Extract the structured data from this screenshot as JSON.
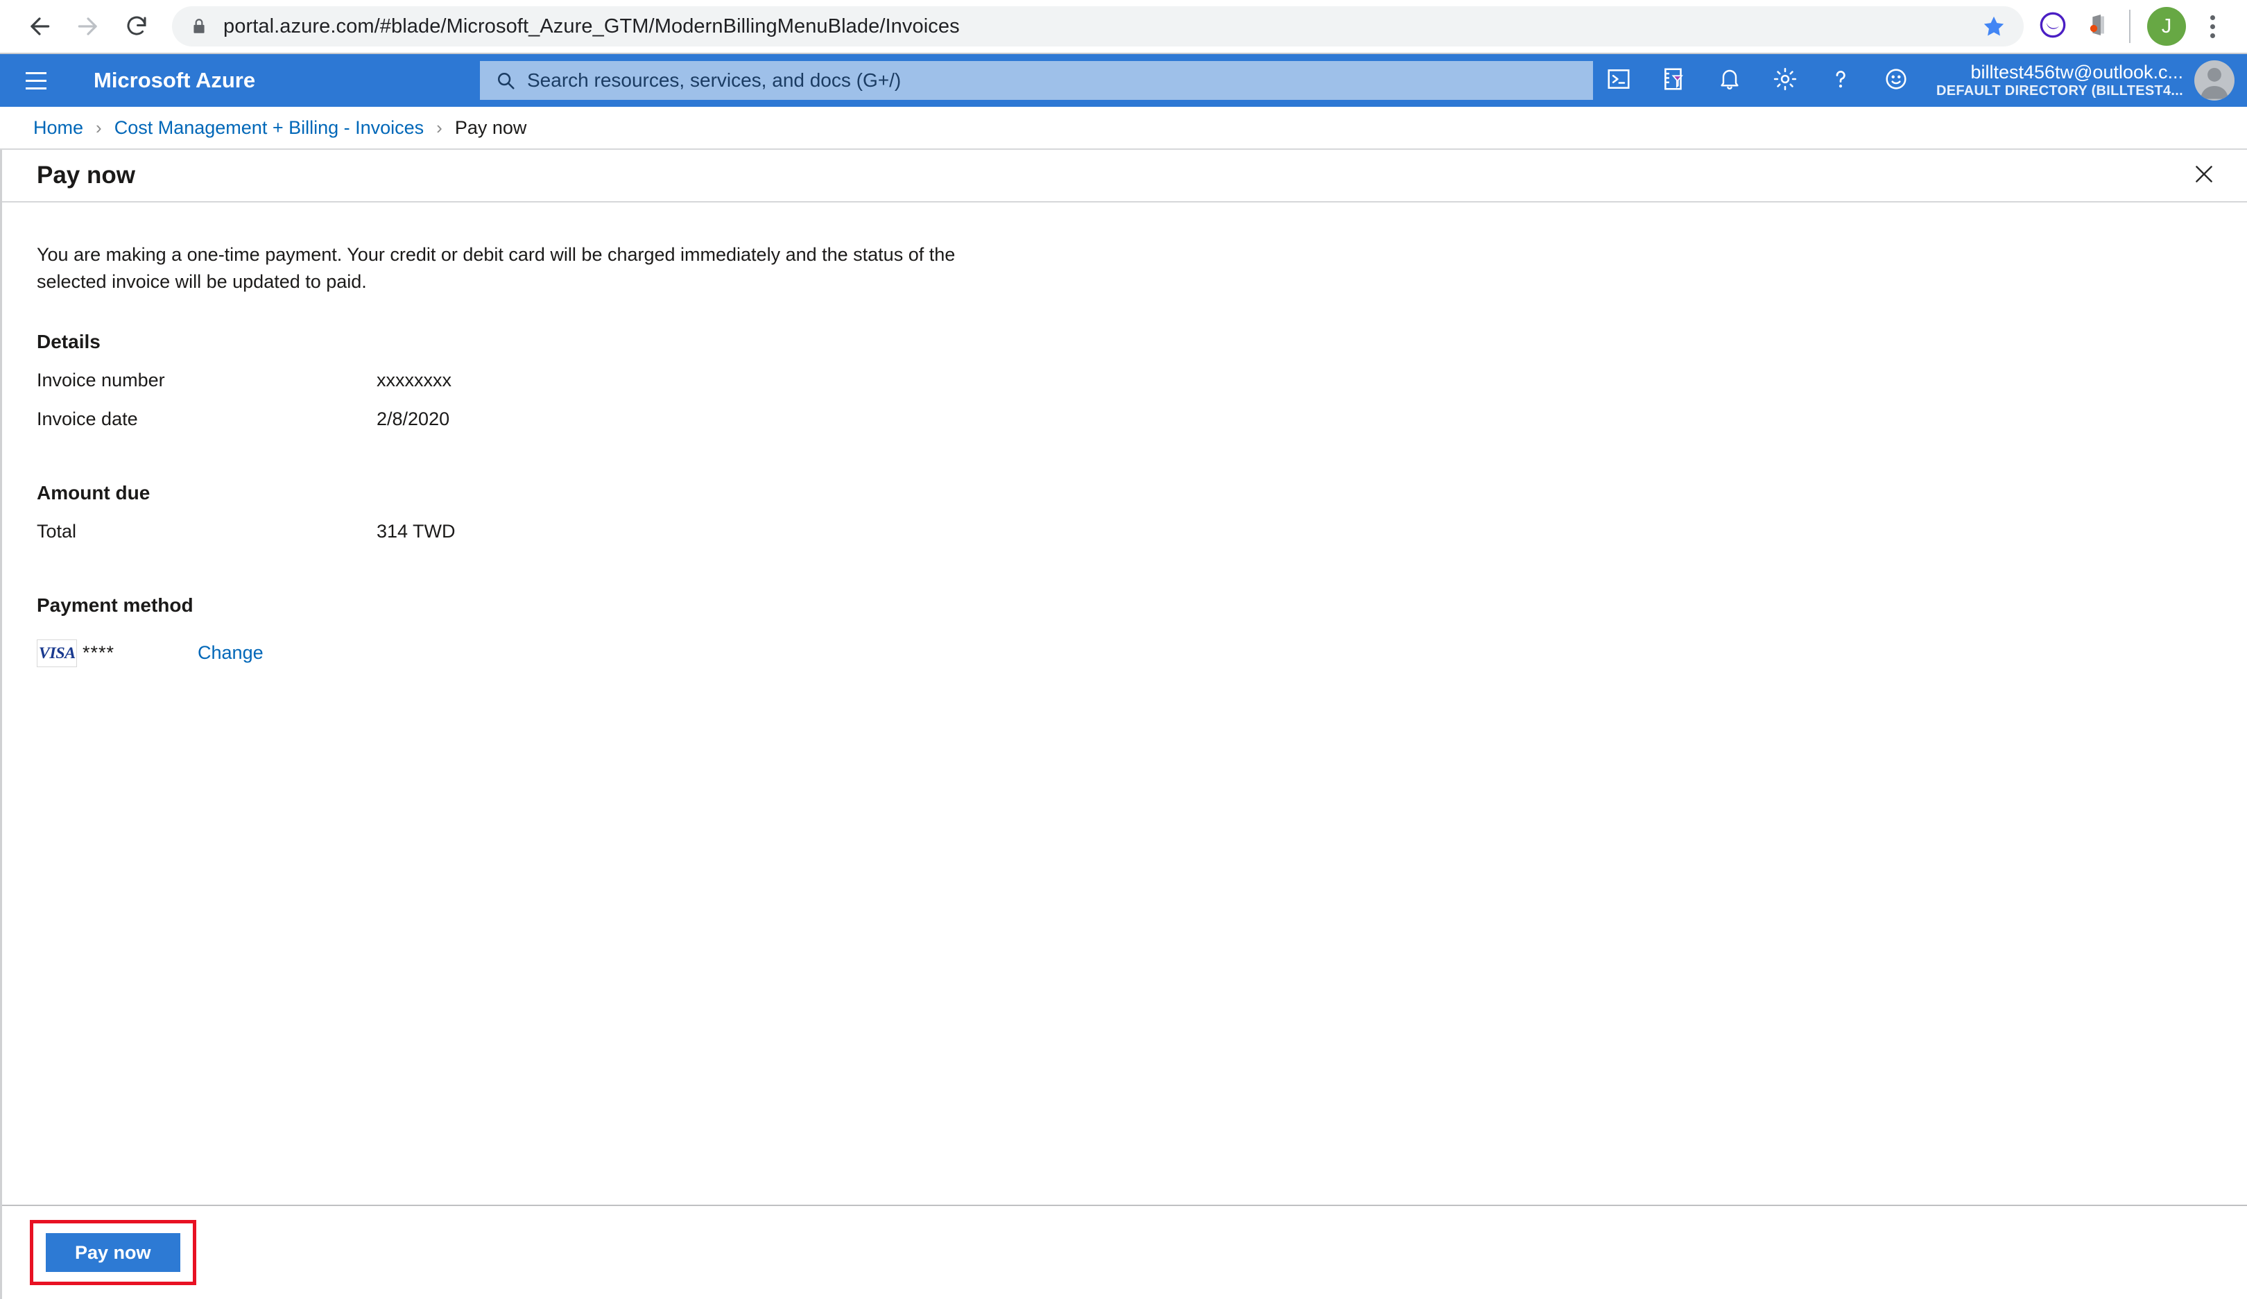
{
  "browser": {
    "url": "portal.azure.com/#blade/Microsoft_Azure_GTM/ModernBillingMenuBlade/Invoices",
    "back_icon": "back-arrow-icon",
    "forward_icon": "forward-arrow-icon",
    "reload_icon": "reload-icon",
    "lock_icon": "lock-icon",
    "bookmark_icon": "star-icon",
    "extension1_icon": "purple-circle-extension-icon",
    "extension2_icon": "office-extension-icon",
    "profile_initial": "J",
    "menu_icon": "three-dot-menu-icon"
  },
  "azure_header": {
    "menu_icon": "hamburger-menu-icon",
    "brand": "Microsoft Azure",
    "search": {
      "icon": "search-icon",
      "placeholder": "Search resources, services, and docs (G+/)"
    },
    "actions": [
      {
        "name": "cloud-shell-icon",
        "label": "Cloud Shell"
      },
      {
        "name": "directory-filter-icon",
        "label": "Directories + subscriptions"
      },
      {
        "name": "bell-icon",
        "label": "Notifications"
      },
      {
        "name": "gear-icon",
        "label": "Settings"
      },
      {
        "name": "question-mark-icon",
        "label": "Help"
      },
      {
        "name": "smiley-icon",
        "label": "Feedback"
      }
    ],
    "account_name": "billtest456tw@outlook.c...",
    "account_directory": "DEFAULT DIRECTORY (BILLTEST4...",
    "avatar_icon": "user-avatar-icon"
  },
  "breadcrumb": {
    "items": [
      {
        "label": "Home",
        "link": true
      },
      {
        "label": "Cost Management + Billing - Invoices",
        "link": true
      },
      {
        "label": "Pay now",
        "link": false
      }
    ],
    "separator": "›"
  },
  "blade": {
    "title": "Pay now",
    "close_icon": "close-icon",
    "intro": "You are making a one-time payment. Your credit or debit card will be charged immediately and the status of the selected invoice will be updated to paid.",
    "details": {
      "heading": "Details",
      "rows": [
        {
          "key": "Invoice number",
          "value": "xxxxxxxx"
        },
        {
          "key": "Invoice date",
          "value": "2/8/2020"
        }
      ]
    },
    "amount_due": {
      "heading": "Amount due",
      "rows": [
        {
          "key": "Total",
          "value": "314 TWD"
        }
      ]
    },
    "payment_method": {
      "heading": "Payment method",
      "card_brand": "VISA",
      "card_mask": "****",
      "change_label": "Change"
    },
    "footer": {
      "pay_now_label": "Pay now"
    }
  },
  "colors": {
    "azure_blue": "#2d78d4",
    "link_blue": "#0067b8",
    "button_blue": "#2d7ad4",
    "highlight_red": "#e81123",
    "search_field": "#9ec0e9"
  }
}
